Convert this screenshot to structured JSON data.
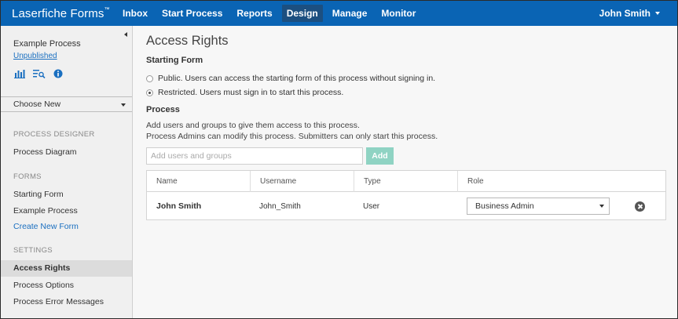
{
  "navbar": {
    "brand": "Laserfiche Forms",
    "brand_mark": "™",
    "items": [
      {
        "label": "Inbox"
      },
      {
        "label": "Start Process"
      },
      {
        "label": "Reports"
      },
      {
        "label": "Design",
        "active": true
      },
      {
        "label": "Manage"
      },
      {
        "label": "Monitor"
      }
    ],
    "user": "John Smith",
    "accent_color": "#0a64b4"
  },
  "sidebar": {
    "process_name": "Example Process",
    "process_status": "Unpublished",
    "icons": [
      "bar-chart-icon",
      "search-list-icon",
      "info-icon"
    ],
    "choose_new": "Choose New",
    "sections": {
      "designer": "PROCESS DESIGNER",
      "forms": "FORMS",
      "settings": "SETTINGS"
    },
    "designer_items": [
      "Process Diagram"
    ],
    "form_items": [
      "Starting Form",
      "Example Process"
    ],
    "create_form": "Create New Form",
    "settings_items": [
      "Access Rights",
      "Process Options",
      "Process Error Messages"
    ]
  },
  "main": {
    "title": "Access Rights",
    "starting_form_heading": "Starting Form",
    "radio_public": "Public. Users can access the starting form of this process without signing in.",
    "radio_restricted": "Restricted. Users must sign in to start this process.",
    "selected_radio": "restricted",
    "process_heading": "Process",
    "help_line1": "Add users and groups to give them access to this process.",
    "help_line2": "Process Admins can modify this process. Submitters can only start this process.",
    "add_placeholder": "Add users and groups",
    "add_button": "Add",
    "add_button_color": "#8fd3c3",
    "table": {
      "columns": [
        "Name",
        "Username",
        "Type",
        "Role"
      ],
      "rows": [
        {
          "name": "John Smith",
          "username": "John_Smith",
          "type": "User",
          "role": "Business Admin"
        }
      ]
    }
  }
}
